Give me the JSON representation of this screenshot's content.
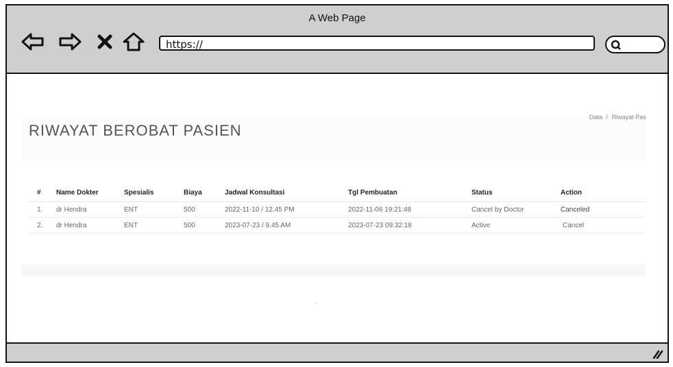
{
  "window": {
    "title": "A Web Page"
  },
  "toolbar": {
    "url": "https://"
  },
  "icons": [
    "back-arrow-icon",
    "forward-arrow-icon",
    "close-x-icon",
    "home-icon",
    "search-icon",
    "resize-grip-icon"
  ],
  "page": {
    "title": "RIWAYAT BEROBAT PASIEN",
    "breadcrumb": {
      "item1": "Data",
      "separator": "/",
      "item2": "Riwayat Pas"
    }
  },
  "table": {
    "headers": [
      "#",
      "Name Dokter",
      "Spesialis",
      "Biaya",
      "Jadwal Konsultasi",
      "Tgl Pembuatan",
      "Status",
      "Action"
    ],
    "rows": [
      {
        "no": "1.",
        "dokter": "dr Hendra",
        "spesialis": "ENT",
        "biaya": "500",
        "jadwal": "2022-11-10 / 12.45 PM",
        "tgl": "2022-11-06 19:21:48",
        "status": "Cancel by Doctor",
        "action": "Canceled"
      },
      {
        "no": "2.",
        "dokter": "dr Hendra",
        "spesialis": "ENT",
        "biaya": "500",
        "jadwal": "2023-07-23 / 9.45 AM",
        "tgl": "2023-07-23 09:32:18",
        "status": "Active",
        "action": "Cancel"
      }
    ]
  },
  "colors": {
    "chrome": "#cfcfcf",
    "link": "#3a7dc9",
    "title": "#555555"
  }
}
